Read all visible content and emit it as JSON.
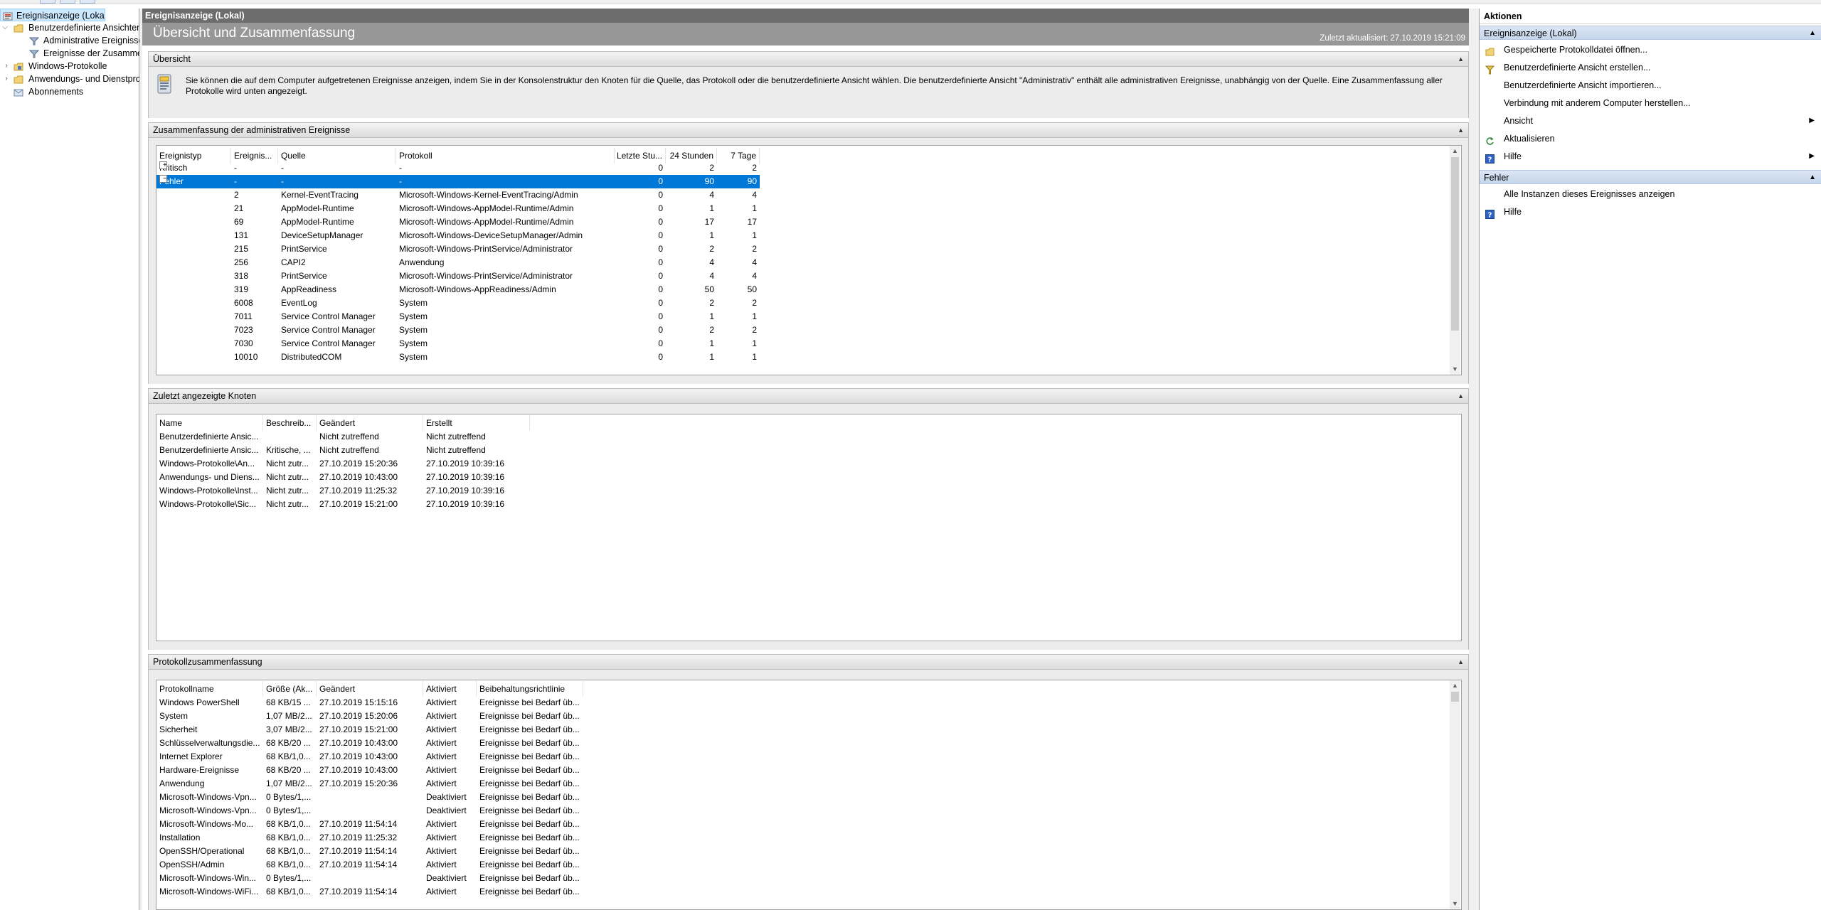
{
  "tree": {
    "items": [
      {
        "label": "Ereignisanzeige (Lokal)",
        "icon": "event-viewer-icon"
      },
      {
        "label": "Benutzerdefinierte Ansichten",
        "icon": "folder-icon"
      },
      {
        "label": "Administrative Ereignisse",
        "icon": "filter-icon"
      },
      {
        "label": "Ereignisse der Zusammenfassung",
        "icon": "filter-icon"
      },
      {
        "label": "Windows-Protokolle",
        "icon": "folder-icon"
      },
      {
        "label": "Anwendungs- und Dienstprotokolle",
        "icon": "folder-icon"
      },
      {
        "label": "Abonnements",
        "icon": "subscription-icon"
      }
    ]
  },
  "center": {
    "title": "Ereignisanzeige (Lokal)",
    "header_title": "Übersicht und Zusammenfassung",
    "last_updated": "Zuletzt aktualisiert: 27.10.2019 15:21:09"
  },
  "overview": {
    "label": "Übersicht",
    "text": "Sie können die auf dem Computer aufgetretenen Ereignisse anzeigen, indem Sie in der Konsolenstruktur den Knoten für die Quelle, das Protokoll oder die benutzerdefinierte Ansicht wählen. Die benutzerdefinierte Ansicht \"Administrativ\" enthält alle administrativen Ereignisse, unabhängig von der Quelle. Eine Zusammenfassung aller Protokolle wird unten angezeigt."
  },
  "admin_summary": {
    "label": "Zusammenfassung der administrativen Ereignisse",
    "columns": [
      "Ereignistyp",
      "Ereignis...",
      "Quelle",
      "Protokoll",
      "Letzte Stu...",
      "24 Stunden",
      "7 Tage"
    ],
    "rows": [
      {
        "type": "Kritisch",
        "expander": "+",
        "id": "-",
        "source": "-",
        "log": "-",
        "h1": "0",
        "h24": "2",
        "d7": "2"
      },
      {
        "type": "Fehler",
        "expander": "−",
        "id": "-",
        "source": "-",
        "log": "-",
        "h1": "0",
        "h24": "90",
        "d7": "90",
        "selected": true
      },
      {
        "type": "",
        "id": "2",
        "source": "Kernel-EventTracing",
        "log": "Microsoft-Windows-Kernel-EventTracing/Admin",
        "h1": "0",
        "h24": "4",
        "d7": "4"
      },
      {
        "type": "",
        "id": "21",
        "source": "AppModel-Runtime",
        "log": "Microsoft-Windows-AppModel-Runtime/Admin",
        "h1": "0",
        "h24": "1",
        "d7": "1"
      },
      {
        "type": "",
        "id": "69",
        "source": "AppModel-Runtime",
        "log": "Microsoft-Windows-AppModel-Runtime/Admin",
        "h1": "0",
        "h24": "17",
        "d7": "17"
      },
      {
        "type": "",
        "id": "131",
        "source": "DeviceSetupManager",
        "log": "Microsoft-Windows-DeviceSetupManager/Admin",
        "h1": "0",
        "h24": "1",
        "d7": "1"
      },
      {
        "type": "",
        "id": "215",
        "source": "PrintService",
        "log": "Microsoft-Windows-PrintService/Administrator",
        "h1": "0",
        "h24": "2",
        "d7": "2"
      },
      {
        "type": "",
        "id": "256",
        "source": "CAPI2",
        "log": "Anwendung",
        "h1": "0",
        "h24": "4",
        "d7": "4"
      },
      {
        "type": "",
        "id": "318",
        "source": "PrintService",
        "log": "Microsoft-Windows-PrintService/Administrator",
        "h1": "0",
        "h24": "4",
        "d7": "4"
      },
      {
        "type": "",
        "id": "319",
        "source": "AppReadiness",
        "log": "Microsoft-Windows-AppReadiness/Admin",
        "h1": "0",
        "h24": "50",
        "d7": "50"
      },
      {
        "type": "",
        "id": "6008",
        "source": "EventLog",
        "log": "System",
        "h1": "0",
        "h24": "2",
        "d7": "2"
      },
      {
        "type": "",
        "id": "7011",
        "source": "Service Control Manager",
        "log": "System",
        "h1": "0",
        "h24": "1",
        "d7": "1"
      },
      {
        "type": "",
        "id": "7023",
        "source": "Service Control Manager",
        "log": "System",
        "h1": "0",
        "h24": "2",
        "d7": "2"
      },
      {
        "type": "",
        "id": "7030",
        "source": "Service Control Manager",
        "log": "System",
        "h1": "0",
        "h24": "1",
        "d7": "1"
      },
      {
        "type": "",
        "id": "10010",
        "source": "DistributedCOM",
        "log": "System",
        "h1": "0",
        "h24": "1",
        "d7": "1"
      }
    ]
  },
  "recent_nodes": {
    "label": "Zuletzt angezeigte Knoten",
    "columns": [
      "Name",
      "Beschreib...",
      "Geändert",
      "Erstellt"
    ],
    "rows": [
      {
        "name": "Benutzerdefinierte Ansic...",
        "desc": "",
        "changed": "Nicht zutreffend",
        "created": "Nicht zutreffend"
      },
      {
        "name": "Benutzerdefinierte Ansic...",
        "desc": "Kritische, ...",
        "changed": "Nicht zutreffend",
        "created": "Nicht zutreffend"
      },
      {
        "name": "Windows-Protokolle\\An...",
        "desc": "Nicht zutr...",
        "changed": "27.10.2019 15:20:36",
        "created": "27.10.2019 10:39:16"
      },
      {
        "name": "Anwendungs- und Diens...",
        "desc": "Nicht zutr...",
        "changed": "27.10.2019 10:43:00",
        "created": "27.10.2019 10:39:16"
      },
      {
        "name": "Windows-Protokolle\\Inst...",
        "desc": "Nicht zutr...",
        "changed": "27.10.2019 11:25:32",
        "created": "27.10.2019 10:39:16"
      },
      {
        "name": "Windows-Protokolle\\Sic...",
        "desc": "Nicht zutr...",
        "changed": "27.10.2019 15:21:00",
        "created": "27.10.2019 10:39:16"
      }
    ]
  },
  "log_summary": {
    "label": "Protokollzusammenfassung",
    "columns": [
      "Protokollname",
      "Größe (Ak...",
      "Geändert",
      "Aktiviert",
      "Beibehaltungsrichtlinie"
    ],
    "rows": [
      {
        "name": "Windows PowerShell",
        "size": "68 KB/15 ...",
        "changed": "27.10.2019 15:15:16",
        "enabled": "Aktiviert",
        "policy": "Ereignisse bei Bedarf üb..."
      },
      {
        "name": "System",
        "size": "1,07 MB/2...",
        "changed": "27.10.2019 15:20:06",
        "enabled": "Aktiviert",
        "policy": "Ereignisse bei Bedarf üb..."
      },
      {
        "name": "Sicherheit",
        "size": "3,07 MB/2...",
        "changed": "27.10.2019 15:21:00",
        "enabled": "Aktiviert",
        "policy": "Ereignisse bei Bedarf üb..."
      },
      {
        "name": "Schlüsselverwaltungsdie...",
        "size": "68 KB/20 ...",
        "changed": "27.10.2019 10:43:00",
        "enabled": "Aktiviert",
        "policy": "Ereignisse bei Bedarf üb..."
      },
      {
        "name": "Internet Explorer",
        "size": "68 KB/1,0...",
        "changed": "27.10.2019 10:43:00",
        "enabled": "Aktiviert",
        "policy": "Ereignisse bei Bedarf üb..."
      },
      {
        "name": "Hardware-Ereignisse",
        "size": "68 KB/20 ...",
        "changed": "27.10.2019 10:43:00",
        "enabled": "Aktiviert",
        "policy": "Ereignisse bei Bedarf üb..."
      },
      {
        "name": "Anwendung",
        "size": "1,07 MB/2...",
        "changed": "27.10.2019 15:20:36",
        "enabled": "Aktiviert",
        "policy": "Ereignisse bei Bedarf üb..."
      },
      {
        "name": "Microsoft-Windows-Vpn...",
        "size": "0 Bytes/1,...",
        "changed": "",
        "enabled": "Deaktiviert",
        "policy": "Ereignisse bei Bedarf üb..."
      },
      {
        "name": "Microsoft-Windows-Vpn...",
        "size": "0 Bytes/1,...",
        "changed": "",
        "enabled": "Deaktiviert",
        "policy": "Ereignisse bei Bedarf üb..."
      },
      {
        "name": "Microsoft-Windows-Mo...",
        "size": "68 KB/1,0...",
        "changed": "27.10.2019 11:54:14",
        "enabled": "Aktiviert",
        "policy": "Ereignisse bei Bedarf üb..."
      },
      {
        "name": "Installation",
        "size": "68 KB/1,0...",
        "changed": "27.10.2019 11:25:32",
        "enabled": "Aktiviert",
        "policy": "Ereignisse bei Bedarf üb..."
      },
      {
        "name": "OpenSSH/Operational",
        "size": "68 KB/1,0...",
        "changed": "27.10.2019 11:54:14",
        "enabled": "Aktiviert",
        "policy": "Ereignisse bei Bedarf üb..."
      },
      {
        "name": "OpenSSH/Admin",
        "size": "68 KB/1,0...",
        "changed": "27.10.2019 11:54:14",
        "enabled": "Aktiviert",
        "policy": "Ereignisse bei Bedarf üb..."
      },
      {
        "name": "Microsoft-Windows-Win...",
        "size": "0 Bytes/1,...",
        "changed": "",
        "enabled": "Deaktiviert",
        "policy": "Ereignisse bei Bedarf üb..."
      },
      {
        "name": "Microsoft-Windows-WiFi...",
        "size": "68 KB/1,0...",
        "changed": "27.10.2019 11:54:14",
        "enabled": "Aktiviert",
        "policy": "Ereignisse bei Bedarf üb..."
      }
    ]
  },
  "actions": {
    "title": "Aktionen",
    "groups": [
      {
        "label": "Ereignisanzeige (Lokal)",
        "items": [
          {
            "label": "Gespeicherte Protokolldatei öffnen...",
            "icon": "open-folder-icon"
          },
          {
            "label": "Benutzerdefinierte Ansicht erstellen...",
            "icon": "filter-icon"
          },
          {
            "label": "Benutzerdefinierte Ansicht importieren...",
            "icon": ""
          },
          {
            "label": "Verbindung mit anderem Computer herstellen...",
            "icon": ""
          },
          {
            "label": "Ansicht",
            "icon": "",
            "submenu": true
          },
          {
            "label": "Aktualisieren",
            "icon": "refresh-icon"
          },
          {
            "label": "Hilfe",
            "icon": "help-icon",
            "submenu": true
          }
        ]
      },
      {
        "label": "Fehler",
        "items": [
          {
            "label": "Alle Instanzen dieses Ereignisses anzeigen",
            "icon": ""
          },
          {
            "label": "Hilfe",
            "icon": "help-icon"
          }
        ]
      }
    ]
  },
  "colors": {
    "selection": "#0078d7",
    "header_bg": "#979797",
    "title_bg": "#6d6d6d",
    "action_group_bg": "#c6d6ec"
  }
}
